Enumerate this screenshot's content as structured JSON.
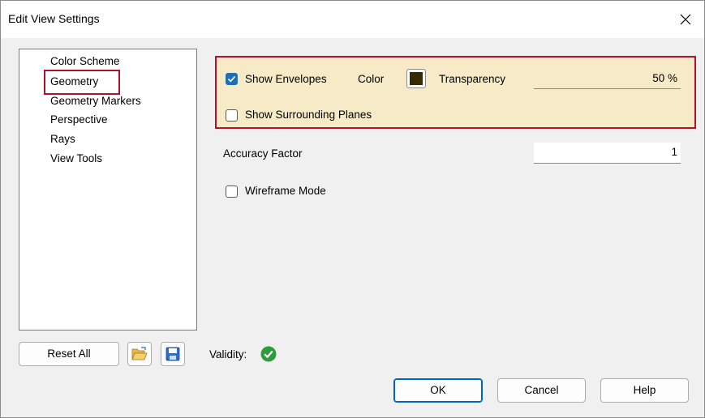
{
  "window": {
    "title": "Edit View Settings"
  },
  "tree": {
    "items": [
      {
        "label": "Color Scheme"
      },
      {
        "label": "Geometry"
      },
      {
        "label": "Geometry Markers"
      },
      {
        "label": "Perspective"
      },
      {
        "label": "Rays"
      },
      {
        "label": "View Tools"
      }
    ],
    "selected": "Geometry"
  },
  "geometry": {
    "show_envelopes": {
      "label": "Show Envelopes",
      "checked": true
    },
    "color_label": "Color",
    "color_value": "#3a2a00",
    "transparency_label": "Transparency",
    "transparency_value": "50 %",
    "show_surrounding_planes": {
      "label": "Show Surrounding Planes",
      "checked": false
    },
    "accuracy_label": "Accuracy Factor",
    "accuracy_value": "1",
    "wireframe": {
      "label": "Wireframe Mode",
      "checked": false
    }
  },
  "footer": {
    "reset_label": "Reset All",
    "validity_label": "Validity:",
    "ok_label": "OK",
    "cancel_label": "Cancel",
    "help_label": "Help"
  },
  "colors": {
    "highlight_border": "#b0122d",
    "panel_bg": "#f6ebc6",
    "check_blue": "#1f6fb5",
    "valid_green": "#2e9c3a"
  }
}
